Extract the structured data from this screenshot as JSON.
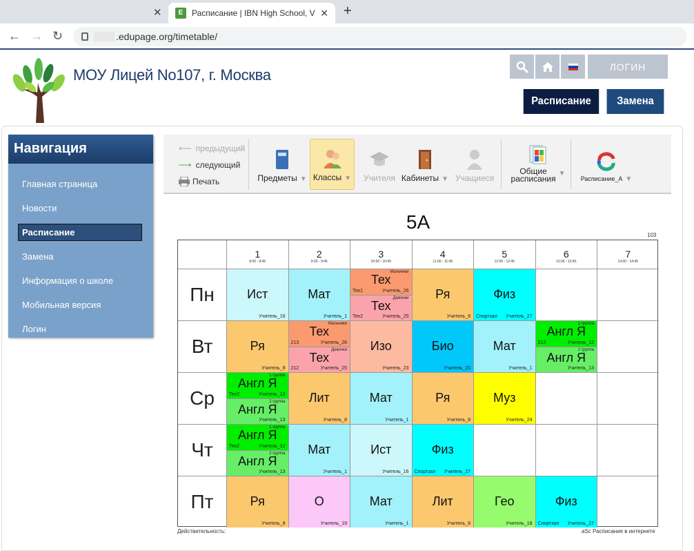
{
  "browser": {
    "tab_title": "Расписание | IBN High School, V",
    "tab_favicon_letter": "E",
    "url": ".edupage.org/timetable/"
  },
  "header": {
    "school_name": "МОУ Лицей No107, г. Москва",
    "login": "ЛОГИН",
    "btn_timetable": "Расписание",
    "btn_substitution": "Замена"
  },
  "nav": {
    "title": "Навигация",
    "items": [
      {
        "label": "Главная страница"
      },
      {
        "label": "Новости"
      },
      {
        "label": "Расписание"
      },
      {
        "label": "Замена"
      },
      {
        "label": "Информация о школе"
      },
      {
        "label": "Мобильная версия"
      },
      {
        "label": "Логин"
      }
    ]
  },
  "toolbar": {
    "prev": "предыдущий",
    "next": "следующий",
    "print": "Печать",
    "subjects": "Предметы",
    "classes": "Классы",
    "teachers": "Учителя",
    "rooms": "Кабинеты",
    "students": "Учащиеся",
    "general1": "Общие",
    "general2": "расписания",
    "version": "Расписание_А"
  },
  "timetable": {
    "title": "5А",
    "room_label": "103",
    "periods": [
      {
        "n": "1",
        "t": "8:00 - 8:45"
      },
      {
        "n": "2",
        "t": "9:00 - 9:45"
      },
      {
        "n": "3",
        "t": "10:00 - 10:45"
      },
      {
        "n": "4",
        "t": "11:00 - 11:45"
      },
      {
        "n": "5",
        "t": "12:00 - 12:45"
      },
      {
        "n": "6",
        "t": "13:00 - 13:45"
      },
      {
        "n": "7",
        "t": "14:00 - 14:45"
      }
    ],
    "days": [
      "Пн",
      "Вт",
      "Ср",
      "Чт",
      "Пт"
    ],
    "footer_left": "Действительность:",
    "footer_right": "aSc Расписания в интернете",
    "lessons": [
      {
        "d": 0,
        "p": 0,
        "parts": [
          {
            "s": "Ист",
            "t": "Учитель_16",
            "c": "#ccf7fb"
          }
        ]
      },
      {
        "d": 0,
        "p": 1,
        "parts": [
          {
            "s": "Мат",
            "t": "Учитель_1",
            "c": "#a3f2fb"
          }
        ]
      },
      {
        "d": 0,
        "p": 2,
        "parts": [
          {
            "s": "Тех",
            "t": "Учитель_26",
            "r": "Тех1",
            "g": "Мальчики",
            "c": "#fb9a6e"
          },
          {
            "s": "Тех",
            "t": "Учитель_25",
            "r": "Тех2",
            "g": "Девочки",
            "c": "#fba3ab"
          }
        ]
      },
      {
        "d": 0,
        "p": 3,
        "parts": [
          {
            "s": "Ря",
            "t": "Учитель_8",
            "c": "#fcc86e"
          }
        ]
      },
      {
        "d": 0,
        "p": 4,
        "parts": [
          {
            "s": "Физ",
            "t": "Учитель_27",
            "r": "Спортзал",
            "c": "#00ffff"
          }
        ]
      },
      {
        "d": 1,
        "p": 0,
        "parts": [
          {
            "s": "Ря",
            "t": "Учитель_8",
            "c": "#fcc86e"
          }
        ]
      },
      {
        "d": 1,
        "p": 1,
        "parts": [
          {
            "s": "Тех",
            "t": "Учитель_26",
            "r": "213",
            "g": "Мальчики",
            "c": "#fb9a6e"
          },
          {
            "s": "Тех",
            "t": "Учитель_25",
            "r": "212",
            "g": "Девочки",
            "c": "#fba3ab"
          }
        ]
      },
      {
        "d": 1,
        "p": 2,
        "parts": [
          {
            "s": "Изо",
            "t": "Учитель_23",
            "c": "#fcbaa0"
          }
        ]
      },
      {
        "d": 1,
        "p": 3,
        "parts": [
          {
            "s": "Био",
            "t": "Учитель_20",
            "c": "#00c8fb"
          }
        ]
      },
      {
        "d": 1,
        "p": 4,
        "parts": [
          {
            "s": "Мат",
            "t": "Учитель_1",
            "c": "#a3f2fb"
          }
        ]
      },
      {
        "d": 1,
        "p": 5,
        "parts": [
          {
            "s": "Англ Я",
            "t": "Учитель_12",
            "r": "213",
            "g": "1 группа",
            "c": "#00ee00"
          },
          {
            "s": "Англ Я",
            "t": "Учитель_13",
            "g": "2 группа",
            "c": "#66ee66"
          }
        ]
      },
      {
        "d": 2,
        "p": 0,
        "parts": [
          {
            "s": "Англ Я",
            "t": "Учитель_12",
            "r": "Тех2",
            "g": "1 группа",
            "c": "#00ee00"
          },
          {
            "s": "Англ Я",
            "t": "Учитель_13",
            "g": "2 группа",
            "c": "#66ee66"
          }
        ]
      },
      {
        "d": 2,
        "p": 1,
        "parts": [
          {
            "s": "Лит",
            "t": "Учитель_8",
            "c": "#fcc86e"
          }
        ]
      },
      {
        "d": 2,
        "p": 2,
        "parts": [
          {
            "s": "Мат",
            "t": "Учитель_1",
            "c": "#a3f2fb"
          }
        ]
      },
      {
        "d": 2,
        "p": 3,
        "parts": [
          {
            "s": "Ря",
            "t": "Учитель_8",
            "c": "#fcc86e"
          }
        ]
      },
      {
        "d": 2,
        "p": 4,
        "parts": [
          {
            "s": "Муз",
            "t": "Учитель_24",
            "c": "#ffff00"
          }
        ]
      },
      {
        "d": 3,
        "p": 0,
        "parts": [
          {
            "s": "Англ Я",
            "t": "Учитель_12",
            "r": "Тех2",
            "g": "1 группа",
            "c": "#00ee00"
          },
          {
            "s": "Англ Я",
            "t": "Учитель_13",
            "g": "2 группа",
            "c": "#66ee66"
          }
        ]
      },
      {
        "d": 3,
        "p": 1,
        "parts": [
          {
            "s": "Мат",
            "t": "Учитель_1",
            "c": "#a3f2fb"
          }
        ]
      },
      {
        "d": 3,
        "p": 2,
        "parts": [
          {
            "s": "Ист",
            "t": "Учитель_16",
            "c": "#ccf7fb"
          }
        ]
      },
      {
        "d": 3,
        "p": 3,
        "parts": [
          {
            "s": "Физ",
            "t": "Учитель_27",
            "r": "Спортзал",
            "c": "#00ffff"
          }
        ]
      },
      {
        "d": 4,
        "p": 0,
        "parts": [
          {
            "s": "Ря",
            "t": "Учитель_8",
            "c": "#fcc86e"
          }
        ]
      },
      {
        "d": 4,
        "p": 1,
        "parts": [
          {
            "s": "О",
            "t": "Учитель_19",
            "c": "#fcc8f8"
          }
        ]
      },
      {
        "d": 4,
        "p": 2,
        "parts": [
          {
            "s": "Мат",
            "t": "Учитель_1",
            "c": "#a3f2fb"
          }
        ]
      },
      {
        "d": 4,
        "p": 3,
        "parts": [
          {
            "s": "Лит",
            "t": "Учитель_8",
            "c": "#fcc86e"
          }
        ]
      },
      {
        "d": 4,
        "p": 4,
        "parts": [
          {
            "s": "Гео",
            "t": "Учитель_18",
            "c": "#97fb6e"
          }
        ]
      },
      {
        "d": 4,
        "p": 5,
        "parts": [
          {
            "s": "Физ",
            "t": "Учитель_27",
            "r": "Спортзал",
            "c": "#00ffff"
          }
        ]
      }
    ]
  }
}
